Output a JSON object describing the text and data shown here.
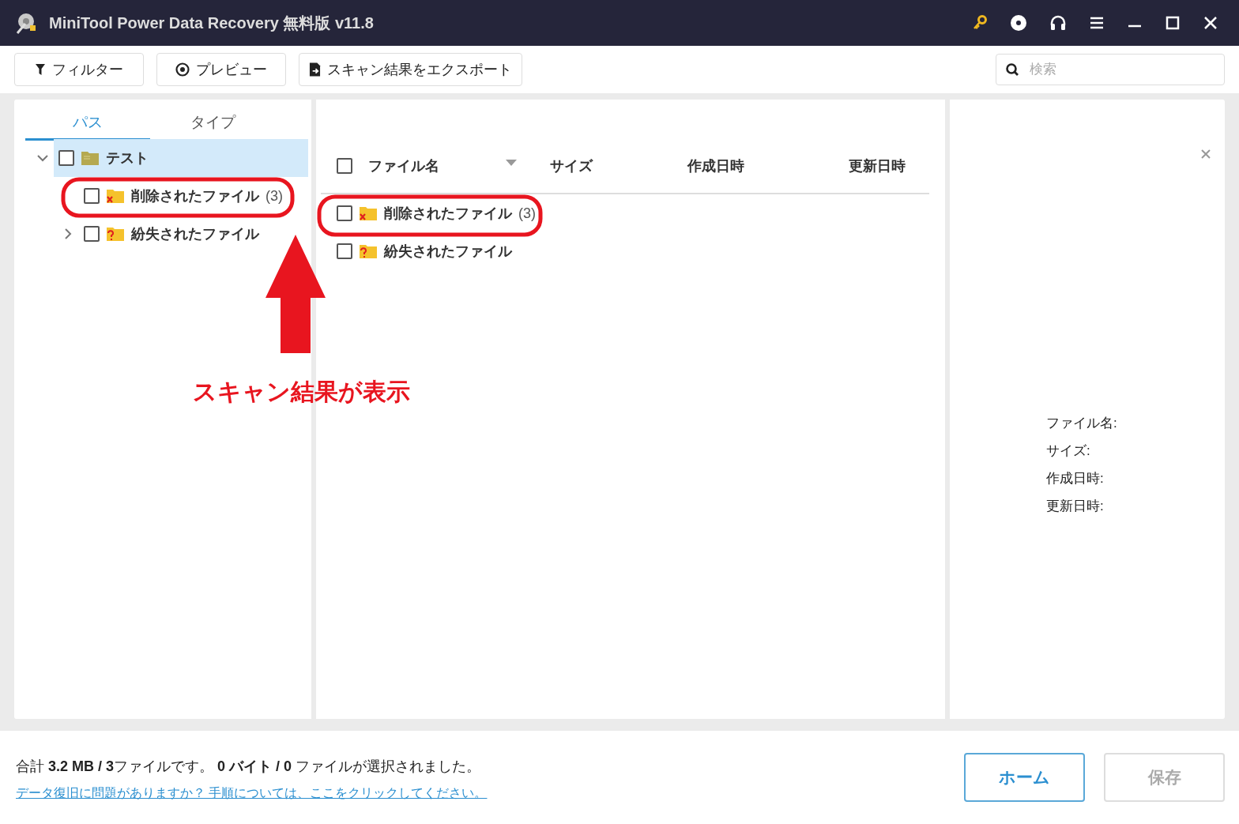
{
  "window": {
    "title": "MiniTool Power Data Recovery 無料版 v11.8"
  },
  "toolbar": {
    "buttons": [
      {
        "kind": "filter",
        "label": "フィルター"
      },
      {
        "kind": "preview",
        "label": "プレビュー"
      },
      {
        "kind": "export",
        "label": "スキャン結果をエクスポート"
      }
    ],
    "search": {
      "placeholder": "検索"
    }
  },
  "tabs": [
    {
      "label": "パス",
      "selected": true
    },
    {
      "label": "タイプ",
      "selected": false
    }
  ],
  "tree": [
    {
      "label": "テスト",
      "kind": "drive",
      "checked": false,
      "expanded": true,
      "selected": true,
      "children": [
        {
          "label": "削除されたファイル",
          "count": "(3)",
          "kind": "deleted",
          "checked": false,
          "selected": false
        },
        {
          "label": "紛失されたファイル",
          "kind": "lost",
          "checked": false,
          "expanded": false,
          "selected": false
        }
      ]
    }
  ],
  "table": {
    "select_all_checked": false,
    "columns": [
      "ファイル名",
      "サイズ",
      "作成日時",
      "更新日時"
    ],
    "rows": [
      {
        "name": "削除されたファイル",
        "count": "(3)",
        "kind": "deleted",
        "checked": false
      },
      {
        "name": "紛失されたファイル",
        "kind": "lost",
        "checked": false
      }
    ]
  },
  "details": {
    "labels": [
      "ファイル名:",
      "サイズ:",
      "作成日時:",
      "更新日時:"
    ]
  },
  "annotation": {
    "caption": "スキャン結果が表示"
  },
  "status_bar": {
    "summary": "合計 **3.2 MB / 3**ファイルです。 **0 バイト / 0** ファイルが選択されました。",
    "help_link": "データ復旧に問題がありますか？ 手順については、ここをクリックしてください。"
  },
  "buttons": [
    {
      "label": "ホーム",
      "disabled": false
    },
    {
      "label": "保存",
      "disabled": true
    }
  ]
}
